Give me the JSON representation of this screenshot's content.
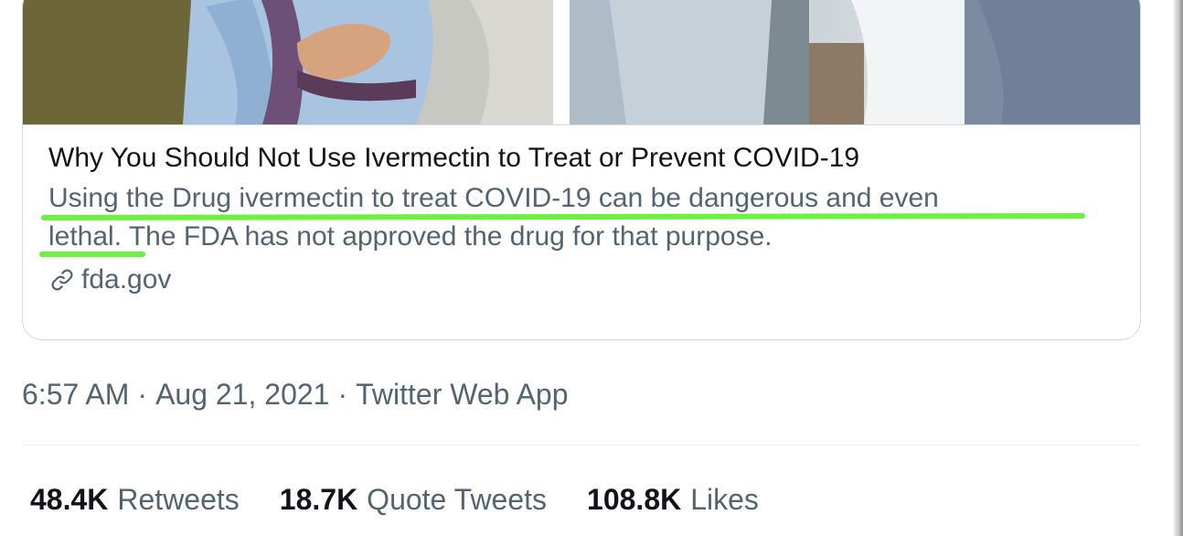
{
  "card": {
    "title": "Why You Should Not Use Ivermectin to Treat or Prevent COVID-19",
    "description_line1": "Using the Drug ivermectin to treat COVID-19 can be dangerous and even",
    "description_line2_highlight": "lethal.",
    "description_line2_rest": " The FDA has not approved the drug for that purpose.",
    "domain": "fda.gov",
    "domain_icon": "link-icon",
    "highlight_color": "#6af23e"
  },
  "meta": {
    "time": "6:57 AM",
    "separator": "·",
    "date": "Aug 21, 2021",
    "source": "Twitter Web App"
  },
  "stats": [
    {
      "count": "48.4K",
      "label": "Retweets"
    },
    {
      "count": "18.7K",
      "label": "Quote Tweets"
    },
    {
      "count": "108.8K",
      "label": "Likes"
    }
  ],
  "colors": {
    "text_primary": "#0f1419",
    "text_secondary": "#536471",
    "border": "#cfd9de"
  }
}
